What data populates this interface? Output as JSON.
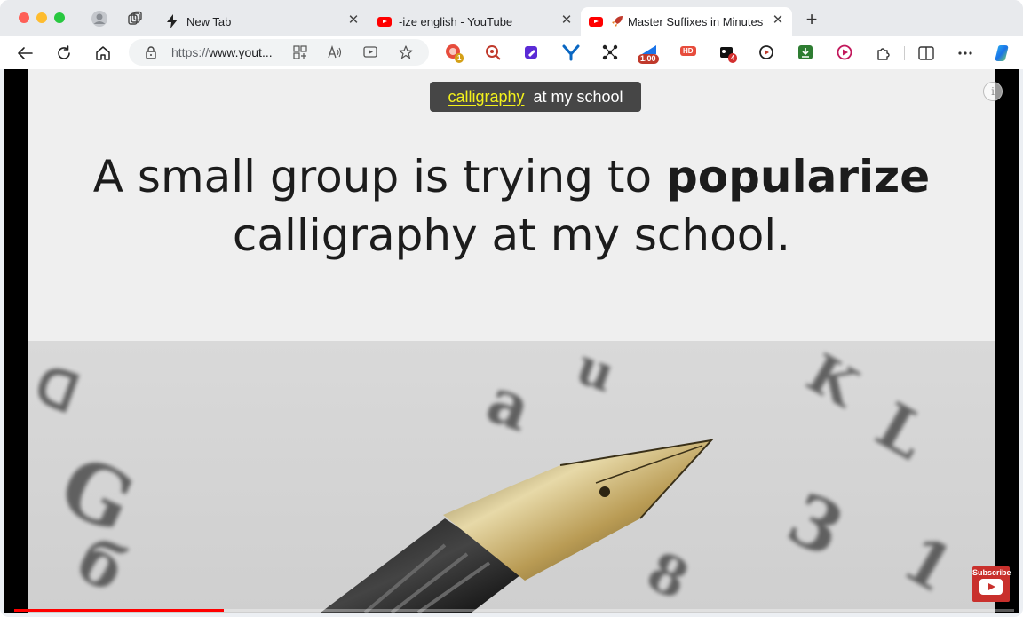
{
  "tabs": [
    {
      "title": "New Tab"
    },
    {
      "title": "-ize english - YouTube"
    },
    {
      "title": "Master Suffixes in Minutes:"
    }
  ],
  "address": {
    "url_prefix": "https://",
    "url_main": "www.yout..."
  },
  "extensions": [
    {
      "name": "ext-red-badge",
      "badge": "1"
    },
    {
      "name": "ext-speed",
      "badge": "1.00"
    },
    {
      "name": "ext-hd",
      "label": "HD"
    },
    {
      "name": "ext-counter",
      "badge": "4"
    }
  ],
  "video": {
    "caption_highlight": "calligraphy",
    "caption_rest": "at my school",
    "sentence_line1_plain": "A small group is trying to ",
    "sentence_line1_bold": "popularize",
    "sentence_line2": "calligraphy at my school.",
    "info_symbol": "i",
    "progress": 0.21,
    "subscribe_label": "Subscribe"
  },
  "colors": {
    "caption_highlight": "#f3f11b",
    "progress": "#ff0000",
    "youtube_red": "#ff0000"
  }
}
